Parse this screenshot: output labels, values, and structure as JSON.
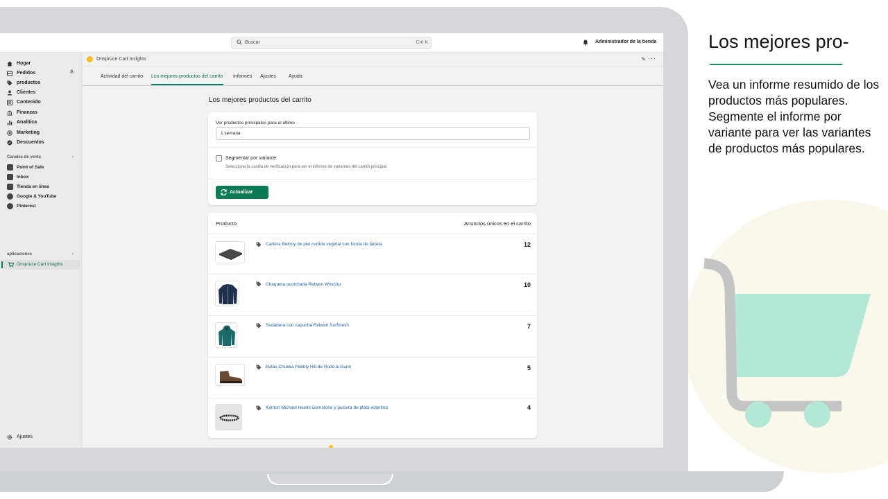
{
  "topbar": {
    "search_placeholder": "Buscar",
    "search_shortcut": "Ctrl K",
    "store_admin": "Administrador de la tienda"
  },
  "sidebar": {
    "items": [
      {
        "label": "Hogar",
        "icon": "home-icon"
      },
      {
        "label": "Pedidos",
        "icon": "orders-icon",
        "count": "8"
      },
      {
        "label": "productos",
        "icon": "tag-icon"
      },
      {
        "label": "Clientes",
        "icon": "person-icon"
      },
      {
        "label": "Contenido",
        "icon": "content-icon"
      },
      {
        "label": "Finanzas",
        "icon": "bank-icon"
      },
      {
        "label": "Analítica",
        "icon": "bar-chart-icon"
      },
      {
        "label": "Marketing",
        "icon": "target-icon"
      },
      {
        "label": "Descuentos",
        "icon": "discount-icon"
      }
    ],
    "sales_channels_heading": "Canales de venta",
    "channels": [
      {
        "label": "Point of Sale",
        "icon": "pos-icon"
      },
      {
        "label": "Inbox",
        "icon": "inbox-icon"
      },
      {
        "label": "Tienda en línea",
        "icon": "store-icon"
      },
      {
        "label": "Google & YouTube",
        "icon": "google-icon"
      },
      {
        "label": "Pinterest",
        "icon": "pinterest-icon"
      }
    ],
    "apps_heading": "aplicaciones",
    "active_app": "Onspruce Cart Insights",
    "settings": "Ajustes"
  },
  "app": {
    "name": "Onspruce Cart Insights",
    "tabs": [
      {
        "label": "Actividad del carrito",
        "active": false
      },
      {
        "label": "Los mejores productos del carrito",
        "active": true
      },
      {
        "label": "Informes",
        "active": false
      },
      {
        "label": "Ajustes",
        "active": false
      },
      {
        "label": "Ayuda",
        "active": false
      }
    ]
  },
  "main": {
    "title": "Los mejores productos del carrito",
    "period_label": "Ver productos principales para el último",
    "period_value": "1 semana",
    "segment_label": "Segmentar por variante",
    "segment_checked": false,
    "segment_help": "Seleccione la casilla de verificación para ver el informe de variantes del carrito principal",
    "update_button": "Actualizar",
    "table": {
      "col_product": "Producto",
      "col_count": "Anuncios únicos en el carrito",
      "rows": [
        {
          "name": "Cartera Bellroy de piel curtida vegetal con funda de tarjeta",
          "count": "12",
          "image": "wallet"
        },
        {
          "name": "Chaqueta acolchada Relwen Windzip",
          "count": "10",
          "image": "jacket"
        },
        {
          "name": "Sudadera con capucha Relwen Surfmesh",
          "count": "7",
          "image": "hoodie"
        },
        {
          "name": "Botas Chukka Pebbly Hill de Rodd & Gunn",
          "count": "5",
          "image": "boot"
        },
        {
          "name": "Kenton Michael Heishi Gemstone y pulsera de plata esterlina",
          "count": "4",
          "image": "bracelet"
        }
      ]
    }
  },
  "promo": {
    "title": "Los mejores pro-",
    "body": "Vea un informe resumido de los productos más populares. Segmente el informe por variante para ver las variantes de productos más populares."
  },
  "colors": {
    "accent": "#008060",
    "link": "#1f5fa8",
    "cart_fill": "#b4e8d6",
    "cart_handle": "#c3c5c4"
  }
}
